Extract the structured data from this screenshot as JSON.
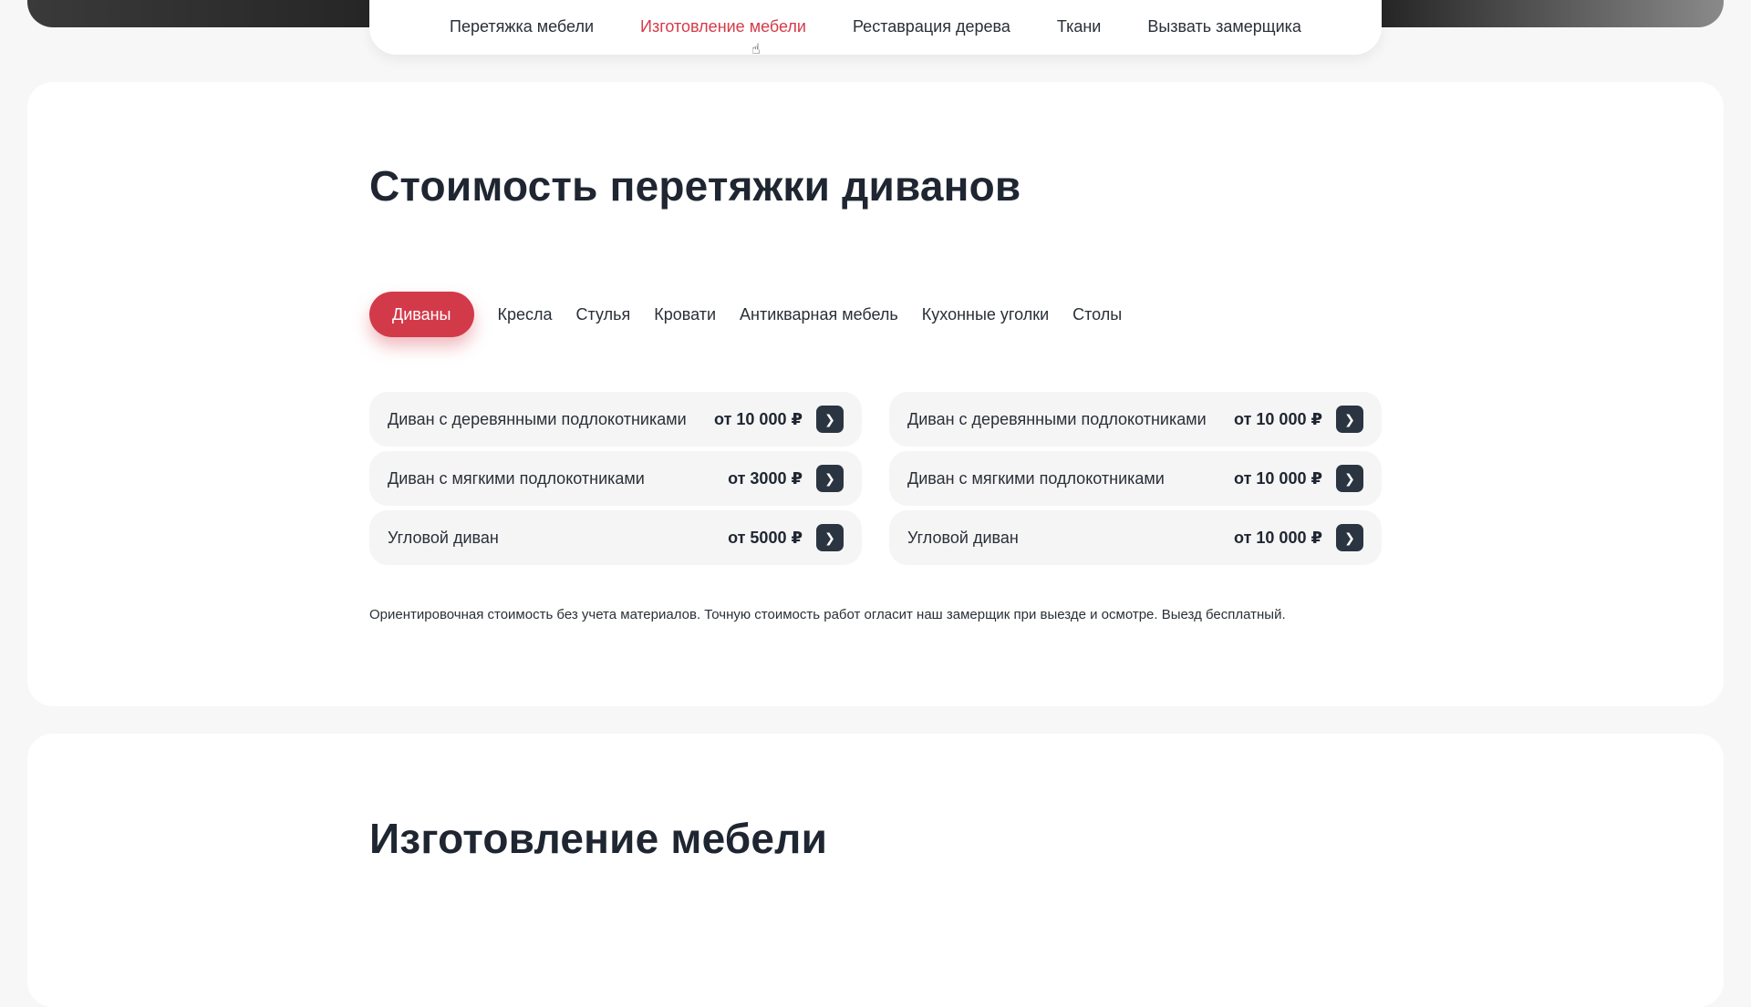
{
  "topnav": {
    "items": [
      {
        "label": "Перетяжка мебели"
      },
      {
        "label": "Изготовление мебели"
      },
      {
        "label": "Реставрация дерева"
      },
      {
        "label": "Ткани"
      },
      {
        "label": "Вызвать замерщика"
      }
    ],
    "active_index": 1
  },
  "prices": {
    "title": "Стоимость перетяжки диванов",
    "tabs": [
      {
        "label": "Диваны"
      },
      {
        "label": "Кресла"
      },
      {
        "label": "Стулья"
      },
      {
        "label": "Кровати"
      },
      {
        "label": "Антикварная мебель"
      },
      {
        "label": "Кухонные уголки"
      },
      {
        "label": "Столы"
      }
    ],
    "active_tab": 0,
    "left_column": [
      {
        "name": "Диван с деревянными подлокотниками",
        "price": "от 10 000 ₽"
      },
      {
        "name": "Диван с мягкими подлокотниками",
        "price": "от 3000 ₽"
      },
      {
        "name": "Угловой диван",
        "price": "от 5000 ₽"
      }
    ],
    "right_column": [
      {
        "name": "Диван с деревянными подлокотниками",
        "price": "от 10 000 ₽"
      },
      {
        "name": "Диван с мягкими подлокотниками",
        "price": "от 10 000 ₽"
      },
      {
        "name": "Угловой диван",
        "price": "от 10 000 ₽"
      }
    ],
    "arrow_glyph": "❯",
    "note": "Ориентировочная стоимость без учета материалов. Точную стоимость работ огласит наш замерщик при выезде и осмотре. Выезд бесплатный."
  },
  "manufacture": {
    "title": "Изготовление мебели"
  },
  "colors": {
    "accent": "#d33a49",
    "arrow_button": "#2b3542",
    "row_background": "#f5f5f5",
    "page_background": "#f7f7f7"
  }
}
